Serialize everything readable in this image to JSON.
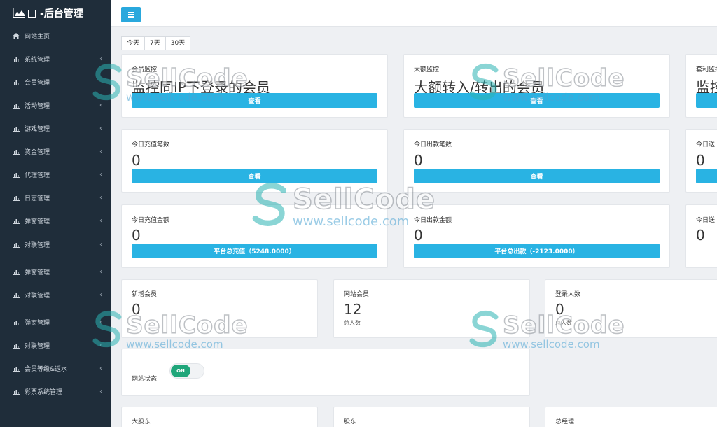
{
  "brand": {
    "title": "-后台管理"
  },
  "sidebar": {
    "items": [
      {
        "label": "网站主页",
        "chevron": "",
        "icon": "home-icon"
      },
      {
        "label": "系统管理",
        "chevron": "‹",
        "icon": "bar-chart-icon"
      },
      {
        "label": "会员管理",
        "chevron": "",
        "icon": "bar-chart-icon"
      },
      {
        "label": "活动管理",
        "chevron": "‹",
        "icon": "bar-chart-icon"
      },
      {
        "label": "游戏管理",
        "chevron": "‹",
        "icon": "bar-chart-icon"
      },
      {
        "label": "资金管理",
        "chevron": "‹",
        "icon": "bar-chart-icon"
      },
      {
        "label": "代理管理",
        "chevron": "‹",
        "icon": "bar-chart-icon"
      },
      {
        "label": "日志管理",
        "chevron": "‹",
        "icon": "bar-chart-icon"
      },
      {
        "label": "弹窗管理",
        "chevron": "‹",
        "icon": "bar-chart-icon"
      },
      {
        "label": "对联管理",
        "chevron": "‹",
        "icon": "bar-chart-icon"
      },
      {
        "label": "弹窗管理",
        "chevron": "‹",
        "icon": "bar-chart-icon"
      },
      {
        "label": "对联管理",
        "chevron": "‹",
        "icon": "bar-chart-icon"
      },
      {
        "label": "弹窗管理",
        "chevron": "‹",
        "icon": "bar-chart-icon"
      },
      {
        "label": "对联管理",
        "chevron": "‹",
        "icon": "bar-chart-icon"
      },
      {
        "label": "会员等级&返水",
        "chevron": "‹",
        "icon": "bar-chart-icon"
      },
      {
        "label": "彩票系统管理",
        "chevron": "‹",
        "icon": "bar-chart-icon"
      }
    ]
  },
  "range": [
    "今天",
    "7天",
    "30天"
  ],
  "monitor": [
    {
      "label": "会员监控",
      "text": "监控同IP下登录的会员",
      "button": "查看"
    },
    {
      "label": "大额监控",
      "text": "大额转入/转出的会员",
      "button": "查看"
    },
    {
      "label": "套利监控",
      "text": "监控",
      "button": ""
    }
  ],
  "counts": [
    {
      "label": "今日充值笔数",
      "value": "0",
      "button": "查看"
    },
    {
      "label": "今日出款笔数",
      "value": "0",
      "button": "查看"
    },
    {
      "label": "今日送",
      "value": "0",
      "button": ""
    }
  ],
  "amounts": [
    {
      "label": "今日充值金额",
      "value": "0",
      "button": "平台总充值（5248.0000）"
    },
    {
      "label": "今日出款金额",
      "value": "0",
      "button": "平台总出款（-2123.0000）"
    },
    {
      "label": "今日送",
      "value": "0",
      "button": ""
    }
  ],
  "members": [
    {
      "label": "新增会员",
      "value": "0",
      "sub": ""
    },
    {
      "label": "网站会员",
      "value": "12",
      "sub": "总人数"
    },
    {
      "label": "登录人数",
      "value": "0",
      "sub": "总人数"
    }
  ],
  "site_status": {
    "label": "网站状态",
    "toggle": "ON"
  },
  "roles": [
    {
      "label": "大股东"
    },
    {
      "label": "股东"
    },
    {
      "label": "总经理"
    }
  ],
  "watermark": {
    "title": "SellCode",
    "url": "www.sellcode.com"
  },
  "colors": {
    "sidebar": "#1f2d3a",
    "accent": "#29b3e3",
    "toggle_on": "#1fa67a"
  }
}
